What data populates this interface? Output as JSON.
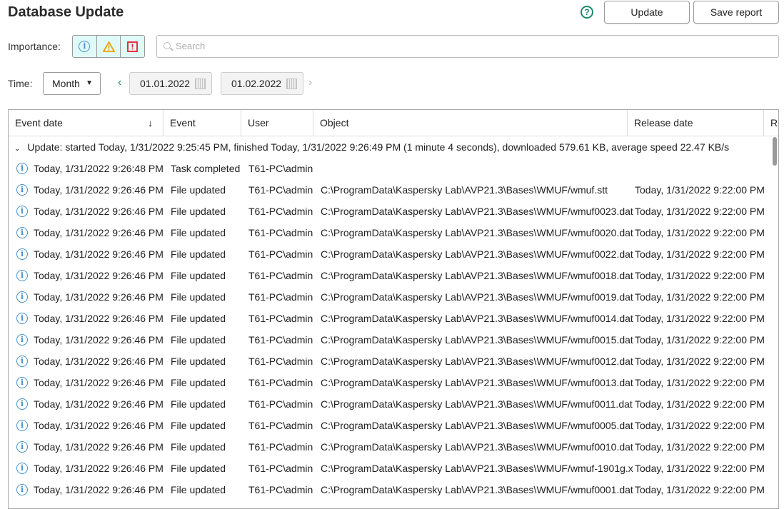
{
  "header": {
    "title": "Database Update",
    "help_icon": "?",
    "update_label": "Update",
    "save_report_label": "Save report"
  },
  "filters": {
    "importance_label": "Importance:",
    "search_placeholder": "Search",
    "time_label": "Time:",
    "period": "Month",
    "date_from": "01.01.2022",
    "date_to": "01.02.2022"
  },
  "colors": {
    "info": "#4a90c8",
    "warning": "#f0a000",
    "error": "#e0202a",
    "accent": "#1a8a6e"
  },
  "table": {
    "columns": [
      "Event date",
      "Event",
      "User",
      "Object",
      "Release date",
      "Re"
    ],
    "group": "Update: started Today, 1/31/2022 9:25:45 PM, finished Today, 1/31/2022 9:26:49 PM (1 minute 4 seconds), downloaded 579.61 KB, average speed 22.47 KB/s",
    "rows": [
      [
        "Today, 1/31/2022 9:26:48 PM",
        "Task completed",
        "T61-PC\\admin",
        "",
        ""
      ],
      [
        "Today, 1/31/2022 9:26:46 PM",
        "File updated",
        "T61-PC\\admin",
        "C:\\ProgramData\\Kaspersky Lab\\AVP21.3\\Bases\\WMUF/wmuf.stt",
        "Today, 1/31/2022 9:22:00 PM"
      ],
      [
        "Today, 1/31/2022 9:26:46 PM",
        "File updated",
        "T61-PC\\admin",
        "C:\\ProgramData\\Kaspersky Lab\\AVP21.3\\Bases\\WMUF/wmuf0023.dat",
        "Today, 1/31/2022 9:22:00 PM"
      ],
      [
        "Today, 1/31/2022 9:26:46 PM",
        "File updated",
        "T61-PC\\admin",
        "C:\\ProgramData\\Kaspersky Lab\\AVP21.3\\Bases\\WMUF/wmuf0020.dat",
        "Today, 1/31/2022 9:22:00 PM"
      ],
      [
        "Today, 1/31/2022 9:26:46 PM",
        "File updated",
        "T61-PC\\admin",
        "C:\\ProgramData\\Kaspersky Lab\\AVP21.3\\Bases\\WMUF/wmuf0022.dat",
        "Today, 1/31/2022 9:22:00 PM"
      ],
      [
        "Today, 1/31/2022 9:26:46 PM",
        "File updated",
        "T61-PC\\admin",
        "C:\\ProgramData\\Kaspersky Lab\\AVP21.3\\Bases\\WMUF/wmuf0018.dat",
        "Today, 1/31/2022 9:22:00 PM"
      ],
      [
        "Today, 1/31/2022 9:26:46 PM",
        "File updated",
        "T61-PC\\admin",
        "C:\\ProgramData\\Kaspersky Lab\\AVP21.3\\Bases\\WMUF/wmuf0019.dat",
        "Today, 1/31/2022 9:22:00 PM"
      ],
      [
        "Today, 1/31/2022 9:26:46 PM",
        "File updated",
        "T61-PC\\admin",
        "C:\\ProgramData\\Kaspersky Lab\\AVP21.3\\Bases\\WMUF/wmuf0014.dat",
        "Today, 1/31/2022 9:22:00 PM"
      ],
      [
        "Today, 1/31/2022 9:26:46 PM",
        "File updated",
        "T61-PC\\admin",
        "C:\\ProgramData\\Kaspersky Lab\\AVP21.3\\Bases\\WMUF/wmuf0015.dat",
        "Today, 1/31/2022 9:22:00 PM"
      ],
      [
        "Today, 1/31/2022 9:26:46 PM",
        "File updated",
        "T61-PC\\admin",
        "C:\\ProgramData\\Kaspersky Lab\\AVP21.3\\Bases\\WMUF/wmuf0012.dat",
        "Today, 1/31/2022 9:22:00 PM"
      ],
      [
        "Today, 1/31/2022 9:26:46 PM",
        "File updated",
        "T61-PC\\admin",
        "C:\\ProgramData\\Kaspersky Lab\\AVP21.3\\Bases\\WMUF/wmuf0013.dat",
        "Today, 1/31/2022 9:22:00 PM"
      ],
      [
        "Today, 1/31/2022 9:26:46 PM",
        "File updated",
        "T61-PC\\admin",
        "C:\\ProgramData\\Kaspersky Lab\\AVP21.3\\Bases\\WMUF/wmuf0011.dat",
        "Today, 1/31/2022 9:22:00 PM"
      ],
      [
        "Today, 1/31/2022 9:26:46 PM",
        "File updated",
        "T61-PC\\admin",
        "C:\\ProgramData\\Kaspersky Lab\\AVP21.3\\Bases\\WMUF/wmuf0005.dat",
        "Today, 1/31/2022 9:22:00 PM"
      ],
      [
        "Today, 1/31/2022 9:26:46 PM",
        "File updated",
        "T61-PC\\admin",
        "C:\\ProgramData\\Kaspersky Lab\\AVP21.3\\Bases\\WMUF/wmuf0010.dat",
        "Today, 1/31/2022 9:22:00 PM"
      ],
      [
        "Today, 1/31/2022 9:26:46 PM",
        "File updated",
        "T61-PC\\admin",
        "C:\\ProgramData\\Kaspersky Lab\\AVP21.3\\Bases\\WMUF/wmuf-1901g.x",
        "Today, 1/31/2022 9:22:00 PM"
      ],
      [
        "Today, 1/31/2022 9:26:46 PM",
        "File updated",
        "T61-PC\\admin",
        "C:\\ProgramData\\Kaspersky Lab\\AVP21.3\\Bases\\WMUF/wmuf0001.dat",
        "Today, 1/31/2022 9:22:00 PM"
      ]
    ]
  }
}
